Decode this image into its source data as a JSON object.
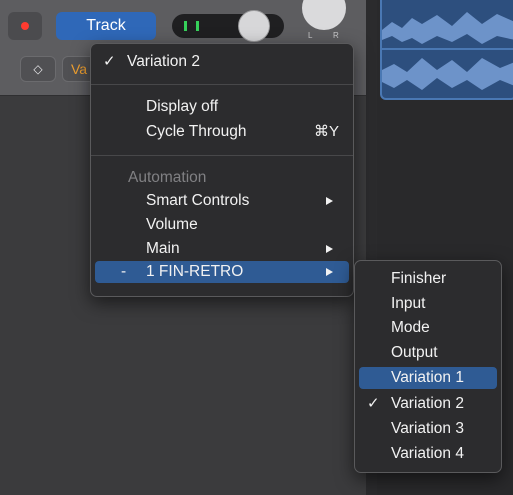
{
  "track_header": {
    "track_button_label": "Track",
    "pan_left_label": "L",
    "pan_right_label": "R",
    "stepper_glyph": "◇",
    "variation_button_label": "Va"
  },
  "context_menu": {
    "current_label": "Variation 2",
    "check_glyph": "✓",
    "display_off_label": "Display off",
    "cycle_through_label": "Cycle Through",
    "cycle_through_shortcut": "⌘Y",
    "automation_header": "Automation",
    "smart_controls_label": "Smart Controls",
    "volume_label": "Volume",
    "main_label": "Main",
    "plugin_prefix": "-",
    "plugin_label": "1 FIN-RETRO"
  },
  "submenu": {
    "items": [
      {
        "label": "Finisher",
        "checked": false,
        "highlighted": false
      },
      {
        "label": "Input",
        "checked": false,
        "highlighted": false
      },
      {
        "label": "Mode",
        "checked": false,
        "highlighted": false
      },
      {
        "label": "Output",
        "checked": false,
        "highlighted": false
      },
      {
        "label": "Variation 1",
        "checked": false,
        "highlighted": true
      },
      {
        "label": "Variation 2",
        "checked": true,
        "highlighted": false
      },
      {
        "label": "Variation 3",
        "checked": false,
        "highlighted": false
      },
      {
        "label": "Variation 4",
        "checked": false,
        "highlighted": false
      }
    ],
    "check_glyph": "✓"
  },
  "colors": {
    "accent_blue": "#2f68b8",
    "highlight_blue": "#2f5b94",
    "record_red": "#ff3b30",
    "meter_green": "#36d05a",
    "variation_orange": "#f0a030",
    "region_blue": "#2d4f7e"
  }
}
